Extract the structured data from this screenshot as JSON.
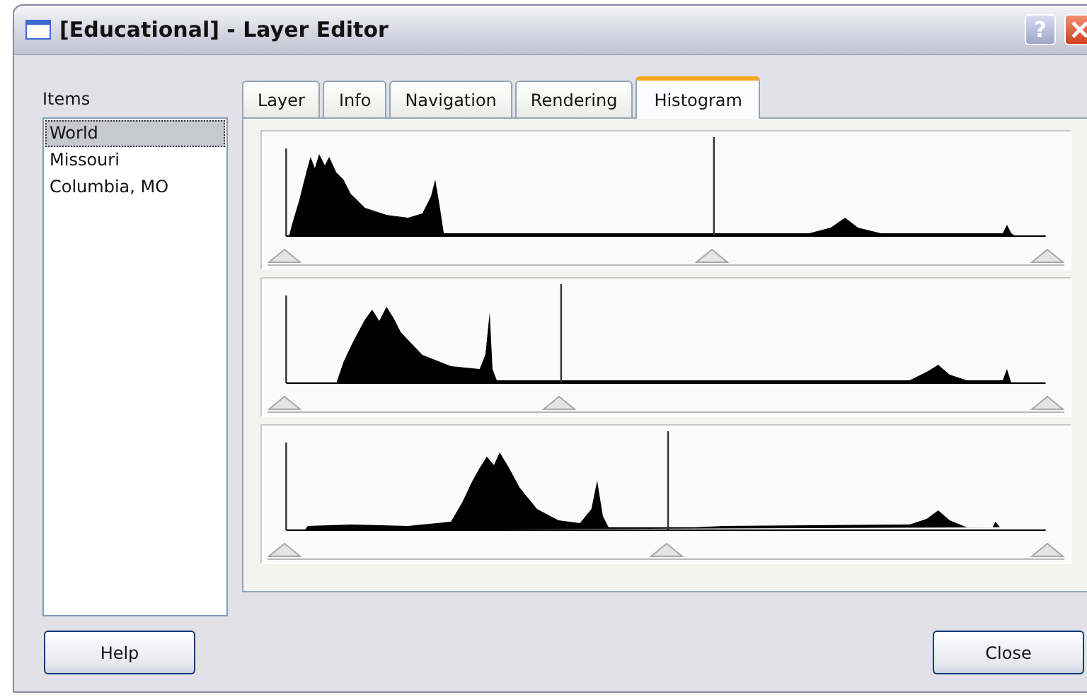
{
  "window": {
    "title": "[Educational] - Layer Editor",
    "help_glyph": "?"
  },
  "items": {
    "label": "Items",
    "list": [
      {
        "text": "World",
        "selected": true
      },
      {
        "text": "Missouri",
        "selected": false
      },
      {
        "text": "Columbia, MO",
        "selected": false
      }
    ]
  },
  "tabs": [
    {
      "label": "Layer",
      "selected": false
    },
    {
      "label": "Info",
      "selected": false
    },
    {
      "label": "Navigation",
      "selected": false
    },
    {
      "label": "Rendering",
      "selected": false
    },
    {
      "label": "Histogram",
      "selected": true
    }
  ],
  "histograms": [
    {
      "thumbs": [
        {
          "level": 0
        },
        {
          "level": 0.56
        },
        {
          "level": 1
        }
      ]
    },
    {
      "thumbs": [
        {
          "level": 0
        },
        {
          "level": 0.36
        },
        {
          "level": 1
        }
      ]
    },
    {
      "thumbs": [
        {
          "level": 0
        },
        {
          "level": 0.5
        },
        {
          "level": 1
        }
      ]
    }
  ],
  "buttons": [
    {
      "label": "Help"
    },
    {
      "label": "Close"
    }
  ]
}
